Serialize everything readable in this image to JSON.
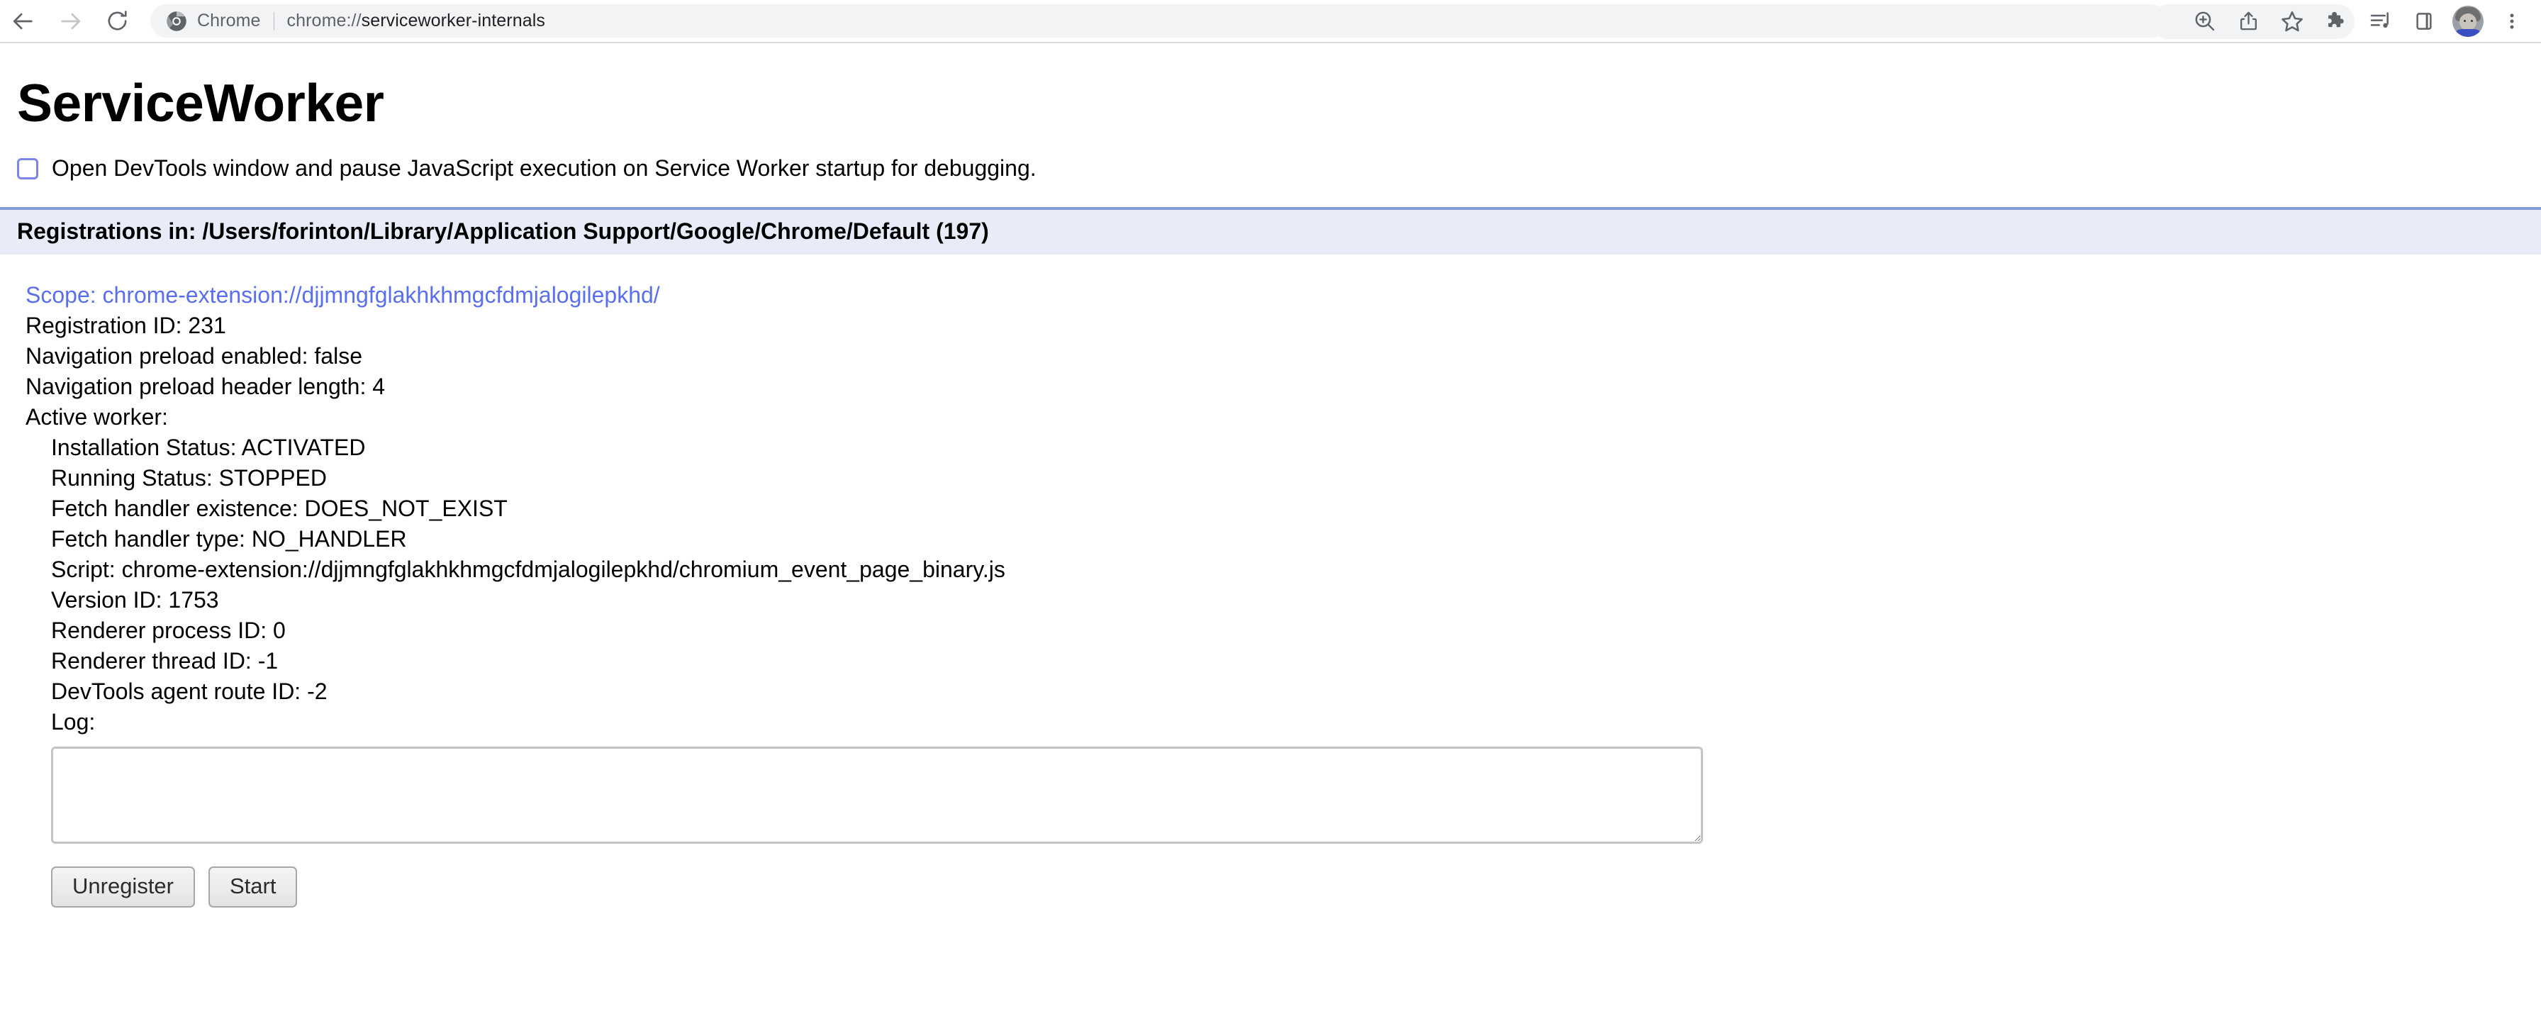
{
  "browser": {
    "nav": {
      "back_icon": "arrow-left-icon",
      "forward_icon": "arrow-right-icon",
      "reload_icon": "reload-icon"
    },
    "omnibox": {
      "brand_icon": "chrome-logo-icon",
      "chip_label": "Chrome",
      "url_scheme": "chrome://",
      "url_path": "serviceworker-internals",
      "url_full": "chrome://serviceworker-internals"
    },
    "actions": [
      {
        "name": "zoom-icon",
        "title": "Zoom"
      },
      {
        "name": "share-icon",
        "title": "Share"
      },
      {
        "name": "star-icon",
        "title": "Bookmark this tab"
      },
      {
        "name": "extensions-puzzle-icon",
        "title": "Extensions"
      },
      {
        "name": "media-control-icon",
        "title": "Media controls"
      },
      {
        "name": "side-panel-icon",
        "title": "Side panel"
      },
      {
        "name": "avatar-icon",
        "title": "Profile"
      },
      {
        "name": "three-dot-menu-icon",
        "title": "Customize and control Google Chrome"
      }
    ],
    "colors": {
      "omnibox_background": "#f1f3f4",
      "toolbar_background": "#ffffff",
      "toolbar_border": "#dadce0",
      "icon_enabled": "#5f6368",
      "icon_disabled": "#bdc1c6"
    }
  },
  "page": {
    "title": "ServiceWorker",
    "devtools_option": {
      "label": "Open DevTools window and pause JavaScript execution on Service Worker startup for debugging.",
      "checked": false
    },
    "registrations_header": "Registrations in: /Users/forinton/Library/Application Support/Google/Chrome/Default (197)",
    "registrations_count": "197",
    "registrations_path": "/Users/forinton/Library/Application Support/Google/Chrome/Default",
    "colors": {
      "header_background": "#e8ecf8",
      "header_top_border": "#7f9bd8",
      "link": "#5a6ff0",
      "text": "#000000",
      "checkbox_border": "#7c86e8"
    },
    "registration": {
      "scope": "Scope: chrome-extension://djjmngfglakhkhmgcfdmjalogilepkhd/",
      "scope_url": "chrome-extension://djjmngfglakhkhmgcfdmjalogilepkhd/",
      "registration_id": "Registration ID: 231",
      "navigation_preload_enabled": "Navigation preload enabled: false",
      "navigation_preload_header_length": "Navigation preload header length: 4",
      "active_worker_label": "Active worker:",
      "worker": {
        "installation_status": "Installation Status: ACTIVATED",
        "running_status": "Running Status: STOPPED",
        "fetch_handler_existence": "Fetch handler existence: DOES_NOT_EXIST",
        "fetch_handler_type": "Fetch handler type: NO_HANDLER",
        "script": "Script: chrome-extension://djjmngfglakhkhmgcfdmjalogilepkhd/chromium_event_page_binary.js",
        "version_id": "Version ID: 1753",
        "renderer_process_id": "Renderer process ID: 0",
        "renderer_thread_id": "Renderer thread ID: -1",
        "devtools_agent_route_id": "DevTools agent route ID: -2",
        "log_label": "Log:",
        "log_value": "",
        "log_placeholder": ""
      }
    },
    "buttons": {
      "unregister": "Unregister",
      "start": "Start"
    }
  }
}
